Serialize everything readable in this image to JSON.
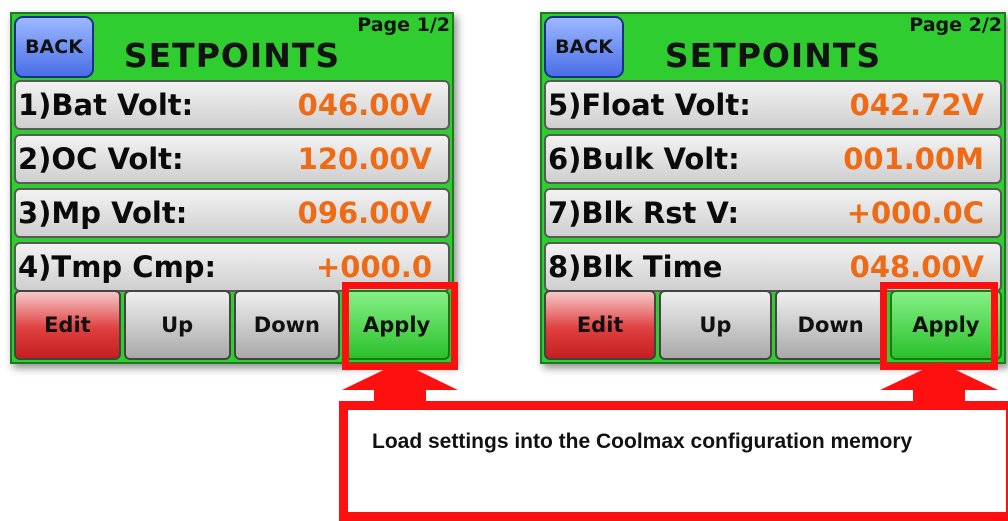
{
  "accent_colors": {
    "panel": "#2fcd2f",
    "value_text": "#ee6a14",
    "highlight": "#ff1010",
    "back_button": "#4a6ee6"
  },
  "panels": [
    {
      "back_label": "BACK",
      "title": "SETPOINTS",
      "page": "Page 1/2",
      "rows": [
        {
          "label": "1)Bat Volt:",
          "value": "046.00V"
        },
        {
          "label": "2)OC Volt:",
          "value": "120.00V"
        },
        {
          "label": "3)Mp Volt:",
          "value": "096.00V"
        },
        {
          "label": "4)Tmp Cmp:",
          "value": "+000.0"
        }
      ],
      "buttons": {
        "edit": "Edit",
        "up": "Up",
        "down": "Down",
        "apply": "Apply"
      }
    },
    {
      "back_label": "BACK",
      "title": "SETPOINTS",
      "page": "Page 2/2",
      "rows": [
        {
          "label": "5)Float Volt:",
          "value": "042.72V"
        },
        {
          "label": "6)Bulk Volt:",
          "value": "001.00M"
        },
        {
          "label": "7)Blk Rst V:",
          "value": "+000.0C"
        },
        {
          "label": "8)Blk Time",
          "value": "048.00V"
        }
      ],
      "buttons": {
        "edit": "Edit",
        "up": "Up",
        "down": "Down",
        "apply": "Apply"
      }
    }
  ],
  "callout": {
    "text": "Load settings into the Coolmax configuration memory"
  }
}
